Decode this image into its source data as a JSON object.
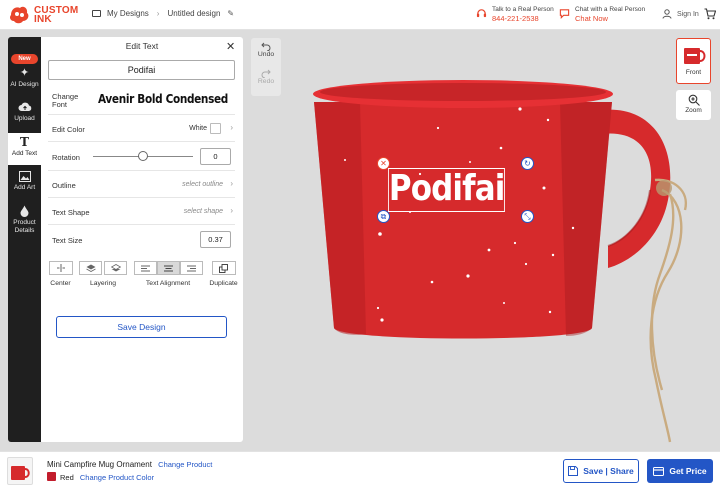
{
  "header": {
    "brand": [
      "CUSTOM",
      "INK"
    ],
    "breadcrumb_root": "My Designs",
    "design_name": "Untitled design",
    "phone_caption": "Talk to a Real Person",
    "phone_number": "844-221-2538",
    "chat_caption": "Chat with a Real Person",
    "chat_link": "Chat Now",
    "signin": "Sign In"
  },
  "rail": {
    "badge": "New",
    "items": [
      {
        "label": "AI Design",
        "icon": "sparkle-icon"
      },
      {
        "label": "Upload",
        "icon": "cloud-upload-icon"
      },
      {
        "label": "Add Text",
        "icon": "text-icon"
      },
      {
        "label": "Add Art",
        "icon": "image-icon"
      },
      {
        "label": "Product Details",
        "icon": "droplet-icon"
      }
    ]
  },
  "panel": {
    "title": "Edit Text",
    "text_value": "Podifai",
    "change_font_label": "Change Font",
    "font_name": "Avenir Bold Condensed",
    "edit_color_label": "Edit Color",
    "edit_color_value": "White",
    "rotation_label": "Rotation",
    "rotation_value": "0",
    "rotation_fraction": 0.5,
    "outline_label": "Outline",
    "outline_value": "select outline",
    "shape_label": "Text Shape",
    "shape_value": "select shape",
    "size_label": "Text Size",
    "size_value": "0.37",
    "tools": {
      "center": "Center",
      "layering": "Layering",
      "alignment": "Text Alignment",
      "duplicate": "Duplicate"
    },
    "save_design": "Save Design"
  },
  "history": {
    "undo": "Undo",
    "redo": "Redo"
  },
  "canvas": {
    "design_text": "Podifai",
    "mug_color": "#d62a2c"
  },
  "views": {
    "front": "Front",
    "zoom": "Zoom"
  },
  "bottom": {
    "product_name": "Mini Campfire Mug Ornament",
    "change_product": "Change Product",
    "color_name": "Red",
    "change_color": "Change Product Color",
    "save_share": "Save | Share",
    "get_price": "Get Price"
  },
  "colors": {
    "accent": "#2356c6",
    "brand": "#e8452c"
  }
}
